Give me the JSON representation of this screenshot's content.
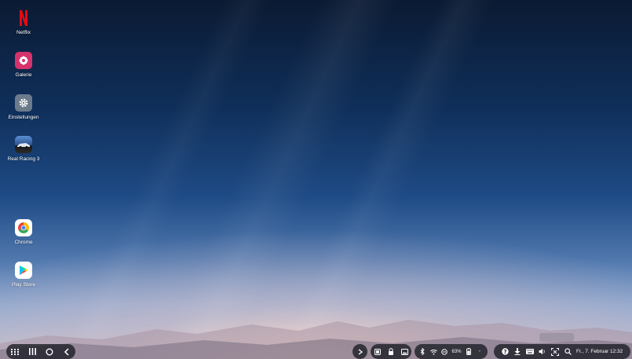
{
  "desktop": {
    "apps": [
      {
        "name": "netflix",
        "label": "Netflix",
        "icon": "netflix-icon"
      },
      {
        "name": "galerie",
        "label": "Galerie",
        "icon": "flower-icon"
      },
      {
        "name": "einstellungen",
        "label": "Einstellungen",
        "icon": "gear-icon"
      },
      {
        "name": "real-racing-3",
        "label": "Real Racing 3",
        "icon": "race-car-icon"
      },
      {
        "name": "chrome",
        "label": "Chrome",
        "icon": "chrome-icon"
      },
      {
        "name": "play-store",
        "label": "Play Store",
        "icon": "play-store-icon"
      }
    ]
  },
  "colors": {
    "netflix": "#e50914",
    "galerie": "#d6336c",
    "einstellungen": "#6b7b8c",
    "taskbar": "#1e2128"
  },
  "taskbar": {
    "nav": [
      "apps-grid-icon",
      "recents-icon",
      "home-icon",
      "back-icon"
    ],
    "expand": "chevron-right-icon",
    "notifications": [
      "screenshot-icon",
      "lock-icon",
      "image-icon"
    ],
    "status": {
      "icons": [
        "bluetooth-icon",
        "wifi-icon",
        "do-not-disturb-icon"
      ],
      "battery": "63%",
      "battery_icon": "battery-icon",
      "more": "-"
    },
    "quick": [
      "help-icon",
      "download-icon",
      "keyboard-icon",
      "volume-icon",
      "fullscreen-icon",
      "search-icon"
    ],
    "datetime": "Fr., 7. Februar 12:32"
  }
}
